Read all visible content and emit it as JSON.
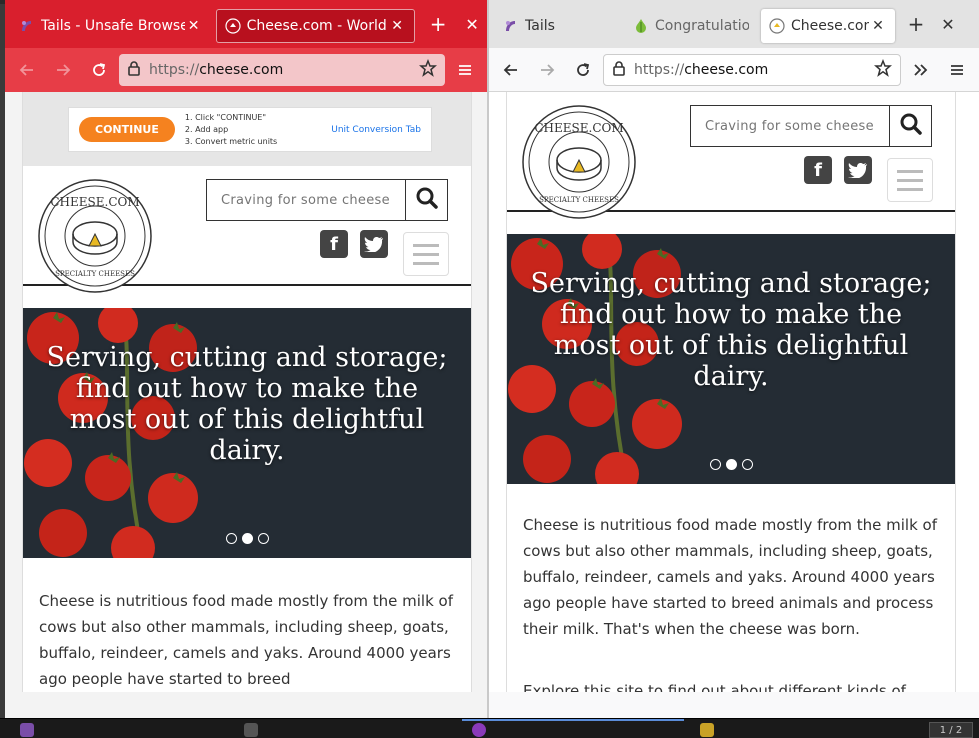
{
  "left_window": {
    "tabs": [
      {
        "title": "Tails - Unsafe Browser",
        "icon": "tails-icon",
        "active": false
      },
      {
        "title": "Cheese.com - World's",
        "icon": "cheese-favicon-icon",
        "active": true
      }
    ],
    "url_scheme": "https://",
    "url_host": "cheese.com",
    "ad": {
      "cta": "CONTINUE",
      "steps": [
        "1. Click \"CONTINUE\"",
        "2. Add app",
        "3. Convert metric units"
      ],
      "brand": "Unit Conversion Tab"
    },
    "search_placeholder": "Craving for some cheese",
    "hero_text": "Serving, cutting and storage; find out how to make the most out of this delightful dairy.",
    "body_text": "Cheese is nutritious food made mostly from the milk of cows but also other mammals, including sheep, goats, buffalo, reindeer, camels and yaks. Around 4000 years ago people have started to breed"
  },
  "right_window": {
    "tabs": [
      {
        "title": "Tails",
        "icon": "tails-icon",
        "active": false
      },
      {
        "title": "Congratulation",
        "icon": "onion-icon",
        "active": false
      },
      {
        "title": "Cheese.com",
        "icon": "cheese-favicon-icon",
        "active": true
      }
    ],
    "url_scheme": "https://",
    "url_host": "cheese.com",
    "search_placeholder": "Craving for some cheese",
    "hero_text": "Serving, cutting and storage; find out how to make the most out of this delightful dairy.",
    "body_text": "Cheese is nutritious food made mostly from the milk of cows but also other mammals, including sheep, goats, buffalo, reindeer, camels and yaks. Around 4000 years ago people have started to breed animals and process their milk. That's when the cheese was born.",
    "body_text_2": "Explore this site to find out about different kinds of"
  },
  "logo": {
    "top_text": "CHEESE.COM",
    "bottom_text": "SPECIALTY CHEESES"
  },
  "taskbar": {
    "pager": "1 / 2"
  },
  "colors": {
    "unsafe_tabbar": "#d91f2d",
    "unsafe_navbar": "#e73d47",
    "hero_bg": "#232b33"
  }
}
